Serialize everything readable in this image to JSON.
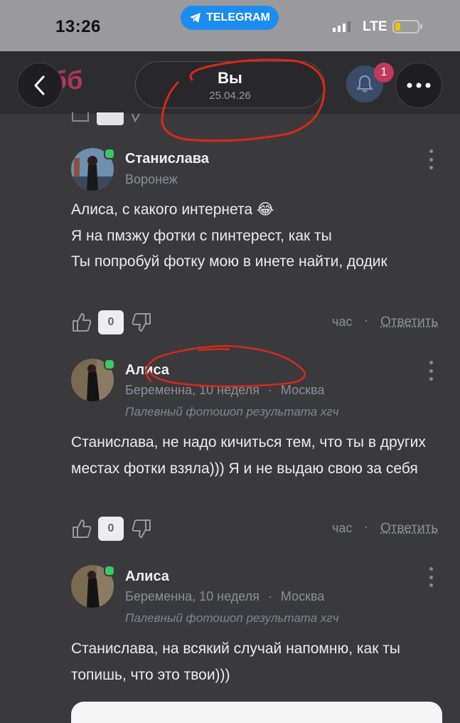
{
  "status_bar": {
    "time": "13:26",
    "telegram_pill": "TELEGRAM",
    "network": "LTE"
  },
  "header": {
    "logo_text": "бб",
    "title": "Вы",
    "date": "25.04.26",
    "notifications_badge": "1"
  },
  "comments": [
    {
      "author": "Станислава",
      "location": "Воронеж",
      "text": "Алиса, с какого интернета 😂\nЯ на пмзжу фотки с пинтерест, как ты\nТы попробуй фотку мою в инете найти, додик",
      "likes": "0",
      "time": "час",
      "reply": "Ответить"
    },
    {
      "author": "Алиса",
      "pregnancy": "Беременна, 10 неделя",
      "location": "Москва",
      "status": "Палевный фотошоп результата хгч",
      "text": "Станислава, не надо кичиться тем, что ты в других местах фотки взяла))) Я и не выдаю свою за себя",
      "likes": "0",
      "time": "час",
      "reply": "Ответить"
    },
    {
      "author": "Алиса",
      "pregnancy": "Беременна, 10 неделя",
      "location": "Москва",
      "status": "Палевный фотошоп результата хгч",
      "text": "Станислава, на всякий случай напомню, как ты топишь, что это твои)))"
    }
  ],
  "colors": {
    "background": "#3a3a3c",
    "accent_pink": "#c0395e",
    "telegram_blue": "#1d8cf0",
    "scribble_red": "#d8281c",
    "online_green": "#3cc863"
  }
}
